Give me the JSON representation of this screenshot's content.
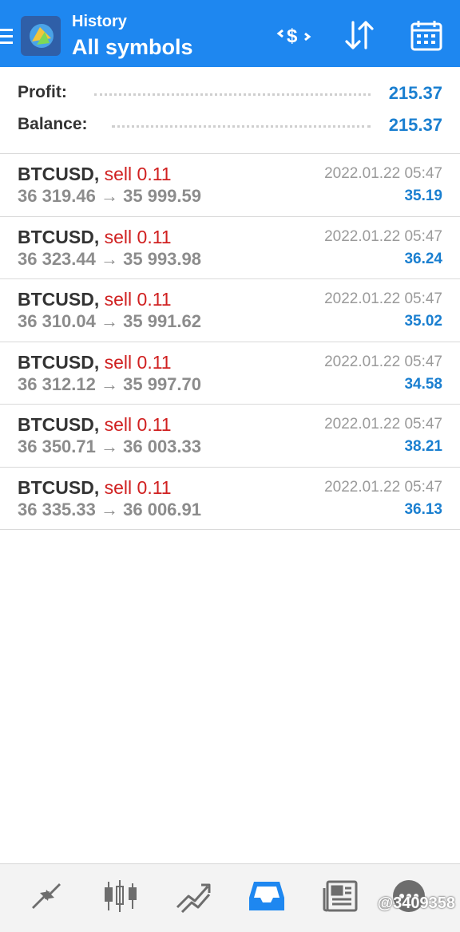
{
  "header": {
    "subtitle": "History",
    "title": "All symbols",
    "icons": [
      "menu-icon",
      "app-logo",
      "currency-exchange-icon",
      "sort-icon",
      "calendar-icon"
    ],
    "colors": {
      "bar": "#1e87f0"
    }
  },
  "summary": {
    "profit_label": "Profit:",
    "profit_value": "215.37",
    "balance_label": "Balance:",
    "balance_value": "215.37"
  },
  "deals": [
    {
      "symbol": "BTCUSD,",
      "side": "sell 0.11",
      "open": "36 319.46",
      "close": "35 999.59",
      "time": "2022.01.22 05:47",
      "profit": "35.19"
    },
    {
      "symbol": "BTCUSD,",
      "side": "sell 0.11",
      "open": "36 323.44",
      "close": "35 993.98",
      "time": "2022.01.22 05:47",
      "profit": "36.24"
    },
    {
      "symbol": "BTCUSD,",
      "side": "sell 0.11",
      "open": "36 310.04",
      "close": "35 991.62",
      "time": "2022.01.22 05:47",
      "profit": "35.02"
    },
    {
      "symbol": "BTCUSD,",
      "side": "sell 0.11",
      "open": "36 312.12",
      "close": "35 997.70",
      "time": "2022.01.22 05:47",
      "profit": "34.58"
    },
    {
      "symbol": "BTCUSD,",
      "side": "sell 0.11",
      "open": "36 350.71",
      "close": "36 003.33",
      "time": "2022.01.22 05:47",
      "profit": "38.21"
    },
    {
      "symbol": "BTCUSD,",
      "side": "sell 0.11",
      "open": "36 335.33",
      "close": "36 006.91",
      "time": "2022.01.22 05:47",
      "profit": "36.13"
    }
  ],
  "arrow": "→",
  "bottom_nav": {
    "items": [
      "quotes-icon",
      "chart-icon",
      "trade-icon",
      "history-icon",
      "news-icon",
      "chat-icon"
    ],
    "active": "history-icon",
    "watermark": "@3409358"
  }
}
